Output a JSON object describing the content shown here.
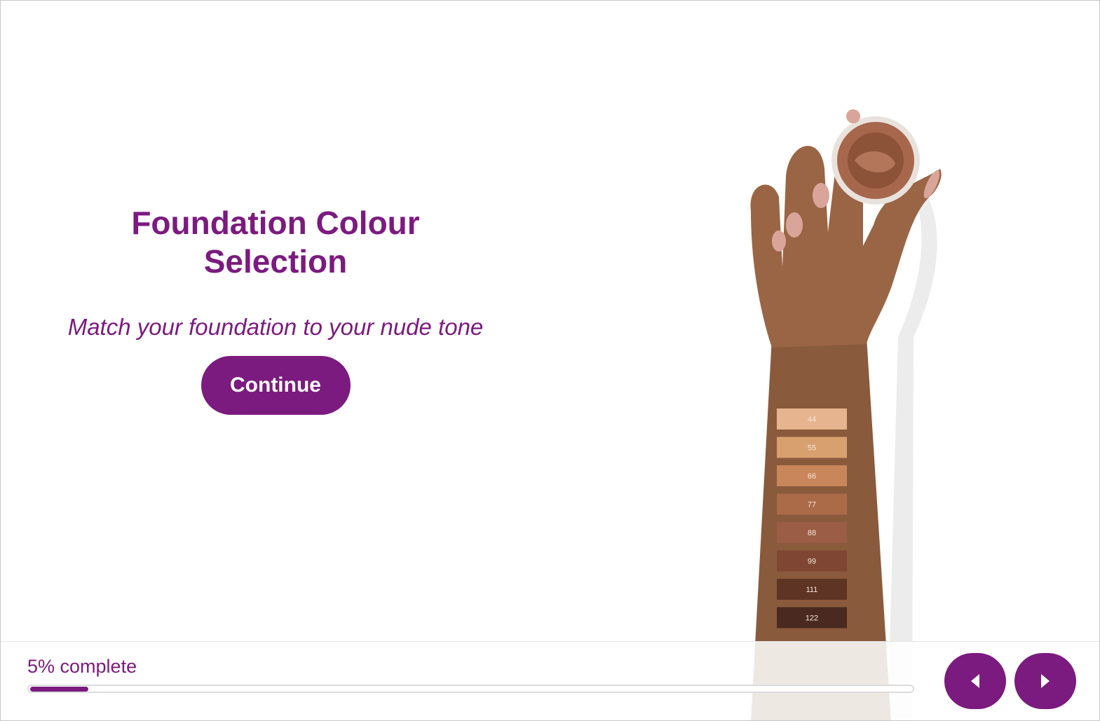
{
  "intro": {
    "title": "Foundation Colour Selection",
    "subtitle": "Match your foundation to your nude tone",
    "continue_label": "Continue"
  },
  "illustration": {
    "swatches": [
      {
        "label": "44",
        "color": "#e6b58f"
      },
      {
        "label": "55",
        "color": "#d8a06f"
      },
      {
        "label": "66",
        "color": "#c8865a"
      },
      {
        "label": "77",
        "color": "#ab6a48"
      },
      {
        "label": "88",
        "color": "#9b5d45"
      },
      {
        "label": "99",
        "color": "#7f4733"
      },
      {
        "label": "111",
        "color": "#5e3425"
      },
      {
        "label": "122",
        "color": "#4a2a20"
      }
    ]
  },
  "footer": {
    "progress_text": "5% complete",
    "progress_fraction": 0.05,
    "prev_icon": "caret-left-icon",
    "next_icon": "caret-right-icon"
  },
  "colors": {
    "accent": "#7b1a7f",
    "track_border": "#dcdcdc"
  }
}
